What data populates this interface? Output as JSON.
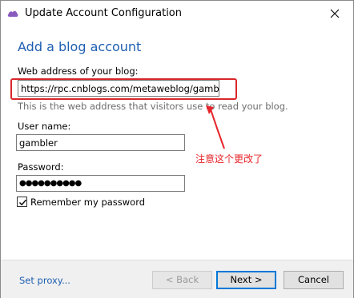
{
  "window": {
    "title": "Update Account Configuration",
    "icon": "cloud-icon",
    "close_icon": "close-icon"
  },
  "form": {
    "heading": "Add a blog account",
    "web_address_label": "Web address of your blog:",
    "web_address_value": "https://rpc.cnblogs.com/metaweblog/gambler",
    "web_address_hint": "This is the web address that visitors use to read your blog.",
    "username_label": "User name:",
    "username_value": "gambler",
    "password_label": "Password:",
    "password_value": "●●●●●●●●●●",
    "remember_label": "Remember my password",
    "remember_checked": true
  },
  "annotation": {
    "text": "注意这个更改了",
    "color": "#e6252a"
  },
  "footer": {
    "proxy_link": "Set proxy...",
    "back_label": "< Back",
    "next_label": "Next >",
    "cancel_label": "Cancel"
  },
  "colors": {
    "accent": "#1f5fb1",
    "highlight_box": "#d9262b",
    "default_button_border": "#0078d7"
  }
}
